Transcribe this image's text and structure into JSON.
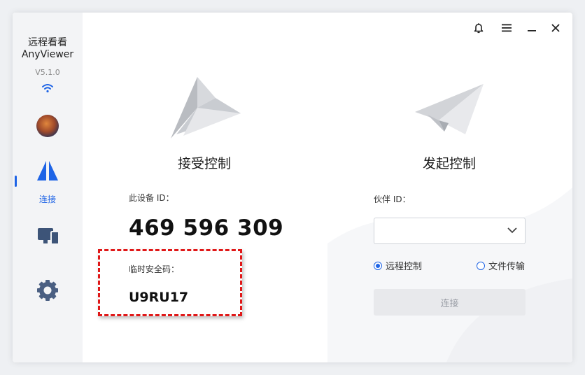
{
  "sidebar": {
    "app_name_cn": "远程看看",
    "app_name_en": "AnyViewer",
    "version": "V5.1.0",
    "nav": [
      {
        "icon": "connect-icon",
        "label": "连接",
        "active": true
      },
      {
        "icon": "screens-icon"
      },
      {
        "icon": "gear-icon"
      }
    ]
  },
  "titlebar": {
    "icons": [
      "bell-icon",
      "menu-icon",
      "minimize-icon",
      "close-icon"
    ]
  },
  "receive": {
    "title": "接受控制",
    "device_id_label": "此设备 ID：",
    "device_id": "469 596 309",
    "temp_code_label": "临时安全码：",
    "temp_code": "U9RU17"
  },
  "initiate": {
    "title": "发起控制",
    "partner_id_label": "伙伴 ID：",
    "partner_id_value": "",
    "options": [
      {
        "label": "远程控制",
        "selected": true
      },
      {
        "label": "文件传输",
        "selected": false
      }
    ],
    "connect_label": "连接"
  },
  "colors": {
    "accent": "#1e64e6",
    "highlight_border": "#e01818",
    "sidebar_bg": "#f3f4f6"
  }
}
